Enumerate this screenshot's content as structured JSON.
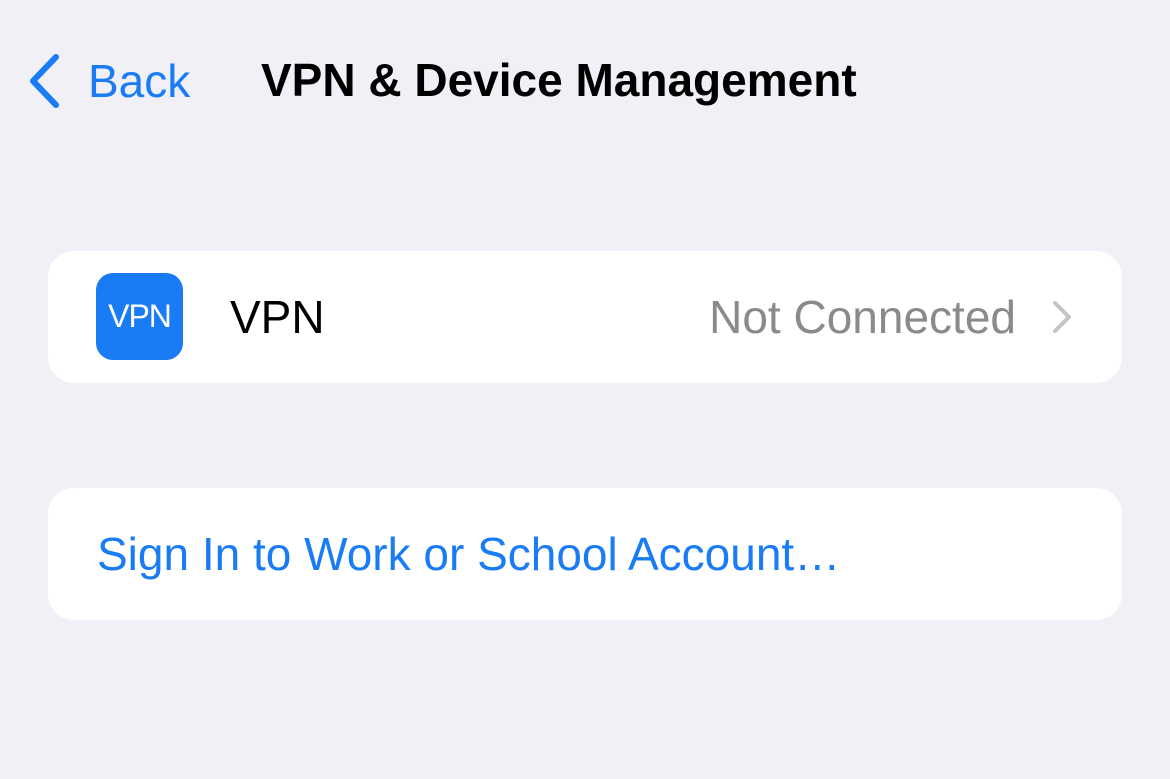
{
  "nav": {
    "back_label": "Back",
    "title": "VPN & Device Management",
    "back_icon": "chevron-left-icon"
  },
  "vpn_row": {
    "icon": "vpn-app-icon",
    "icon_text": "VPN",
    "label": "VPN",
    "status": "Not Connected",
    "disclosure_icon": "chevron-right-icon"
  },
  "account_row": {
    "label": "Sign In to Work or School Account…"
  },
  "colors": {
    "background": "#f0f0f6",
    "card": "#ffffff",
    "accent": "#1a7cf5",
    "secondary_text": "#8a8a8e",
    "chevron": "#c4c4c7"
  }
}
